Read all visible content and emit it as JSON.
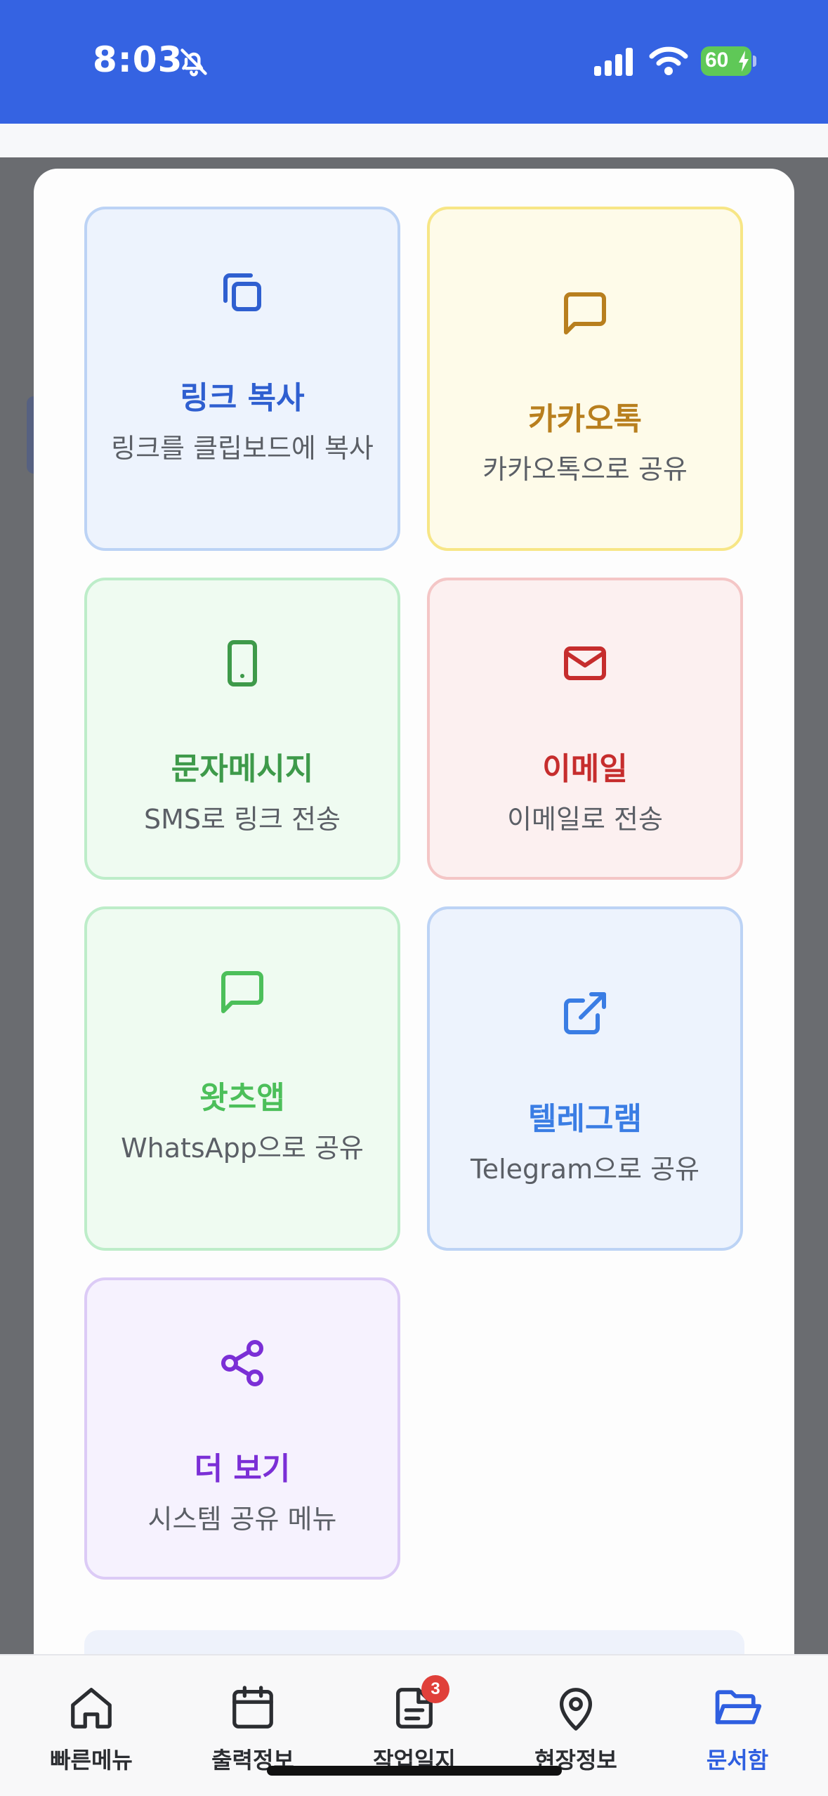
{
  "status": {
    "time": "8:03",
    "battery": "60",
    "colors": {
      "bar": "#3563e2",
      "battery": "#5fc857"
    }
  },
  "share_options": [
    {
      "id": "copy-link",
      "title": "링크 복사",
      "desc": "링크를 클립보드에 복사",
      "icon": "copy-icon",
      "color": "#2f5fd0"
    },
    {
      "id": "kakaotalk",
      "title": "카카오톡",
      "desc": "카카오톡으로 공유",
      "icon": "message-square-icon",
      "color": "#b87f1e"
    },
    {
      "id": "sms",
      "title": "문자메시지",
      "desc": "SMS로 링크 전송",
      "icon": "smartphone-icon",
      "color": "#3e9a4a"
    },
    {
      "id": "email",
      "title": "이메일",
      "desc": "이메일로 전송",
      "icon": "mail-icon",
      "color": "#c62d2d"
    },
    {
      "id": "whatsapp",
      "title": "왓츠앱",
      "desc": "WhatsApp으로 공유",
      "icon": "message-square-icon",
      "color": "#4cbf5a"
    },
    {
      "id": "telegram",
      "title": "텔레그램",
      "desc": "Telegram으로 공유",
      "icon": "external-link-icon",
      "color": "#3a7de4"
    },
    {
      "id": "more",
      "title": "더 보기",
      "desc": "시스템 공유 메뉴",
      "icon": "share-icon",
      "color": "#7b2fd6"
    }
  ],
  "tabbar": {
    "items": [
      {
        "label": "빠른메뉴",
        "icon": "home-icon"
      },
      {
        "label": "출력정보",
        "icon": "calendar-icon"
      },
      {
        "label": "작업일지",
        "icon": "document-icon",
        "badge": "3"
      },
      {
        "label": "현장정보",
        "icon": "map-pin-icon"
      },
      {
        "label": "문서함",
        "icon": "folder-open-icon",
        "active": true
      }
    ],
    "active_color": "#2f5fe0"
  }
}
